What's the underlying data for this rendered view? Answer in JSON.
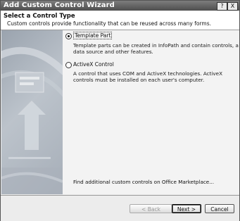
{
  "window": {
    "title": "Add Custom Control Wizard",
    "help_glyph": "?",
    "close_glyph": "X"
  },
  "header": {
    "title": "Select a Control Type",
    "subtitle": "Custom controls provide functionality that can be reused across many forms."
  },
  "options": [
    {
      "label": "Template Part",
      "selected": true,
      "description": [
        "Template parts can be created in InfoPath and contain controls, a",
        "data source and other features."
      ]
    },
    {
      "label": "ActiveX Control",
      "selected": false,
      "description": [
        "A control that uses COM and ActiveX technologies. ActiveX",
        "controls must be installed on each user's computer."
      ]
    }
  ],
  "marketplace_link": "Find additional custom controls on Office Marketplace...",
  "buttons": {
    "back": "< Back",
    "next": "Next >",
    "cancel": "Cancel"
  }
}
